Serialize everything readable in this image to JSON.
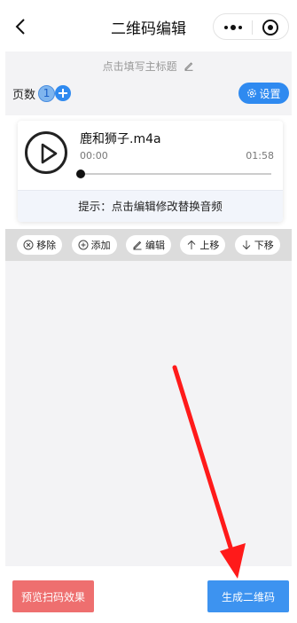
{
  "nav": {
    "title": "二维码编辑"
  },
  "header": {
    "subtitle_placeholder": "点击填写主标题",
    "pages_label": "页数",
    "current_page": "1",
    "settings_label": "设置"
  },
  "audio": {
    "file_name": "鹿和狮子.m4a",
    "current_time": "00:00",
    "duration": "01:58",
    "progress": 0,
    "tip": "提示：点击编辑修改替换音频"
  },
  "actions": {
    "remove": "移除",
    "add": "添加",
    "edit": "编辑",
    "move_up": "上移",
    "move_down": "下移"
  },
  "footer": {
    "preview_label": "预览扫码效果",
    "generate_label": "生成二维码"
  },
  "colors": {
    "primary": "#2f8af0",
    "danger": "#ee6f6f",
    "annotation_arrow": "#ff1a1a"
  }
}
